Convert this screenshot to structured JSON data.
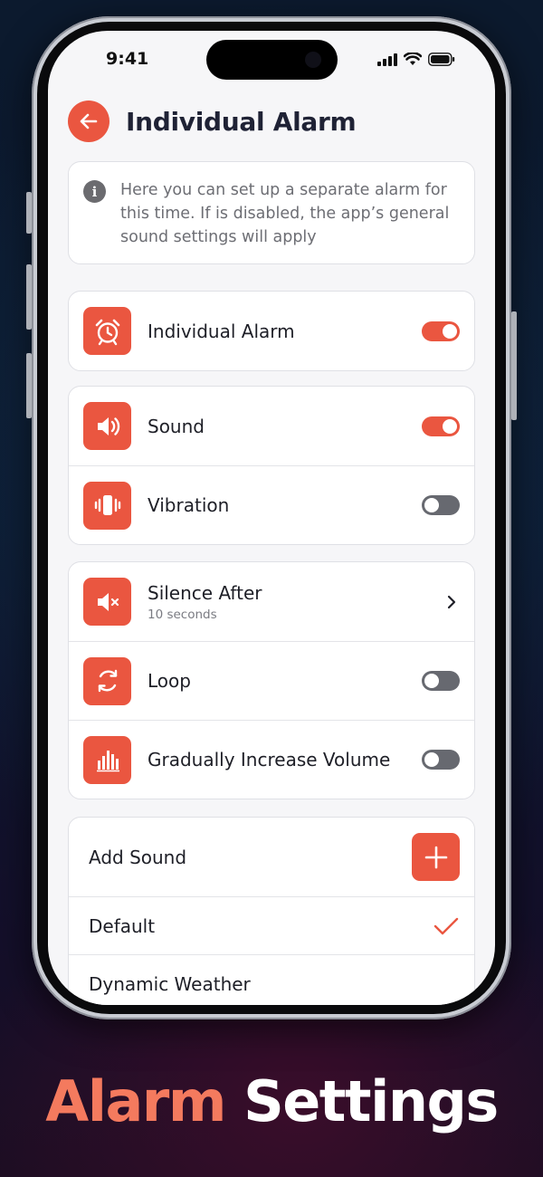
{
  "status_bar": {
    "time": "9:41"
  },
  "header": {
    "title": "Individual Alarm"
  },
  "info": {
    "text": "Here you can set up a separate alarm for this time. If is disabled, the app’s general sound settings will apply"
  },
  "alarm_group": {
    "items": [
      {
        "label": "Individual Alarm",
        "icon": "alarm-clock-icon",
        "enabled": true
      }
    ]
  },
  "sound_group": {
    "items": [
      {
        "label": "Sound",
        "icon": "speaker-icon",
        "enabled": true
      },
      {
        "label": "Vibration",
        "icon": "vibration-icon",
        "enabled": false
      }
    ]
  },
  "options_group": {
    "silence_after": {
      "label": "Silence After",
      "value": "10 seconds",
      "icon": "speaker-mute-icon"
    },
    "loop": {
      "label": "Loop",
      "icon": "loop-icon",
      "enabled": false
    },
    "gradual": {
      "label": "Gradually Increase Volume",
      "icon": "volume-bars-icon",
      "enabled": false
    }
  },
  "sounds": {
    "add_label": "Add Sound",
    "items": [
      {
        "label": "Default",
        "selected": true
      },
      {
        "label": "Dynamic Weather",
        "selected": false
      }
    ]
  },
  "caption": {
    "part1": "Alarm",
    "part2": "Settings"
  },
  "colors": {
    "accent": "#ea5640",
    "toggle_off": "#676970",
    "title": "#1f2235"
  }
}
